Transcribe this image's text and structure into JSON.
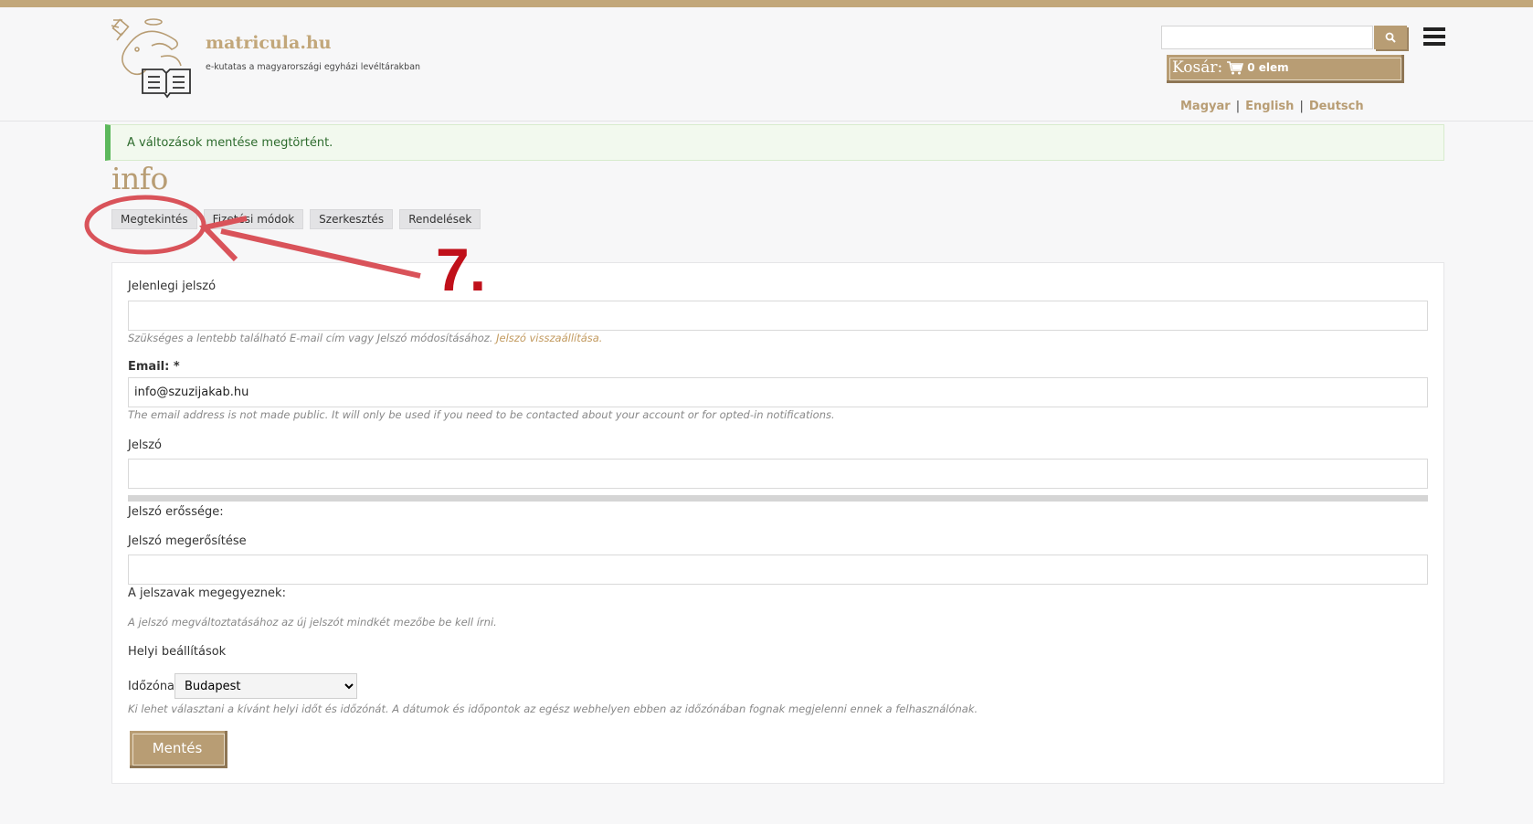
{
  "site": {
    "name": "matricula.hu",
    "tagline": "e-kutatas a magyarországi egyházi levéltárakban",
    "logo_icon": "book-with-seal-logo"
  },
  "header": {
    "search": {
      "value": "",
      "placeholder": "",
      "button_icon": "search-icon"
    },
    "menu_icon": "hamburger-menu-icon",
    "cart": {
      "label": "Kosár:",
      "icon": "cart-icon",
      "count_text": "0 elem"
    },
    "languages": [
      "Magyar",
      "English",
      "Deutsch"
    ]
  },
  "alert": {
    "message": "A változások mentése megtörtént.",
    "status_color": "#5cb85c"
  },
  "page": {
    "title": "info"
  },
  "tabs": [
    {
      "label": "Megtekintés"
    },
    {
      "label": "Fizetési módok"
    },
    {
      "label": "Szerkesztés"
    },
    {
      "label": "Rendelések"
    }
  ],
  "form": {
    "current_password": {
      "label": "Jelenlegi jelszó",
      "value": "",
      "description": "Szükséges a lentebb található E-mail cím vagy Jelszó módosításához.",
      "reset_link": "Jelszó visszaállítása."
    },
    "email": {
      "label": "Email: *",
      "value": "info@szuzijakab.hu",
      "description": "The email address is not made public. It will only be used if you need to be contacted about your account or for opted-in notifications."
    },
    "password": {
      "label": "Jelszó",
      "value": "",
      "strength_label": "Jelszó erőssége:",
      "strength_level": 0
    },
    "password_confirm": {
      "label": "Jelszó megerősítése",
      "value": "",
      "match_label": "A jelszavak megegyeznek:",
      "description": "A jelszó megváltoztatásához az új jelszót mindkét mezőbe be kell írni."
    },
    "locale": {
      "section_title": "Helyi beállítások",
      "timezone_label": "Időzóna",
      "timezone_value": "Budapest",
      "description": "Ki lehet választani a kívánt helyi időt és időzónát. A dátumok és időpontok az egész webhelyen ebben az időzónában fognak megjelenni ennek a felhasználónak."
    },
    "save_label": "Mentés"
  },
  "annotation": {
    "step": "7.",
    "color": "#d9535a"
  },
  "colors": {
    "accent": "#b89d74",
    "top_bar": "#c2a77a",
    "annotation_text": "#c0101a"
  }
}
